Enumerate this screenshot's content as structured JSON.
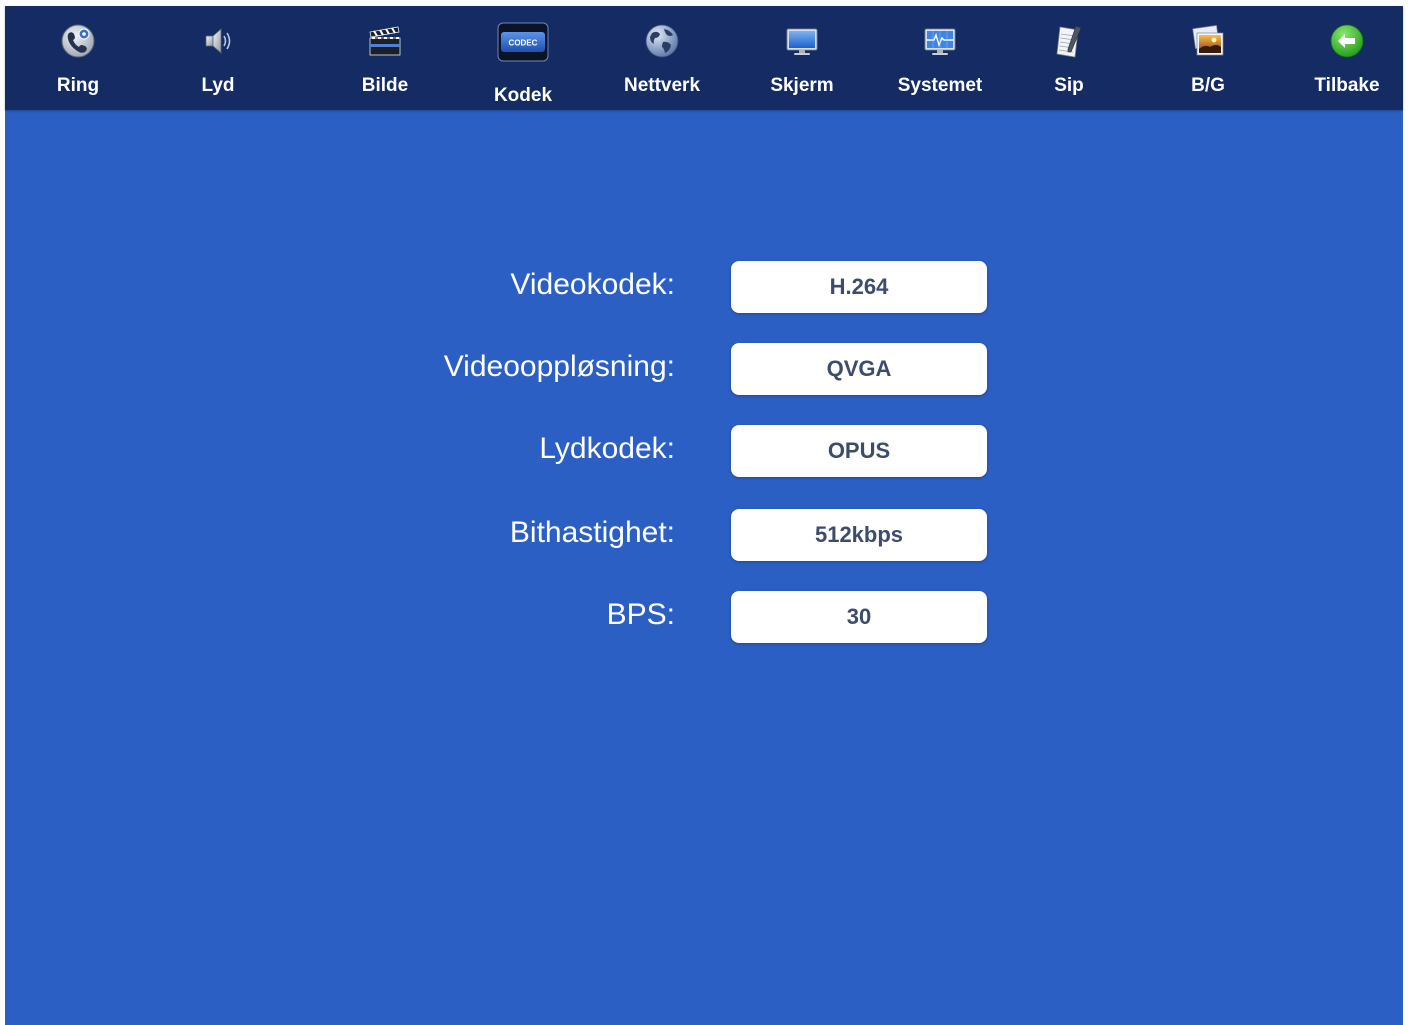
{
  "toolbar": {
    "items": [
      {
        "id": "ring",
        "label": "Ring",
        "icon": "phone-settings-icon"
      },
      {
        "id": "lyd",
        "label": "Lyd",
        "icon": "speaker-icon"
      },
      {
        "id": "bilde",
        "label": "Bilde",
        "icon": "clapperboard-icon"
      },
      {
        "id": "kodek",
        "label": "Kodek",
        "icon": "codec-icon",
        "icon_text": "CODEC",
        "active": true
      },
      {
        "id": "nettverk",
        "label": "Nettverk",
        "icon": "globe-icon"
      },
      {
        "id": "skjerm",
        "label": "Skjerm",
        "icon": "monitor-icon"
      },
      {
        "id": "systemet",
        "label": "Systemet",
        "icon": "system-monitor-icon"
      },
      {
        "id": "sip",
        "label": "Sip",
        "icon": "notepad-icon"
      },
      {
        "id": "bg",
        "label": "B/G",
        "icon": "photos-icon"
      },
      {
        "id": "tilbake",
        "label": "Tilbake",
        "icon": "back-arrow-icon"
      }
    ]
  },
  "settings": [
    {
      "label": "Videokodek:",
      "value": "H.264"
    },
    {
      "label": "Videooppløsning:",
      "value": "QVGA"
    },
    {
      "label": "Lydkodek:",
      "value": "OPUS"
    },
    {
      "label": "Bithastighet:",
      "value": "512kbps"
    },
    {
      "label": "BPS:",
      "value": "30"
    }
  ],
  "colors": {
    "background": "#2c5fc4",
    "toolbar": "#142c63",
    "field_text": "#3d4c6b",
    "back_button_green": "#3fb52b"
  }
}
